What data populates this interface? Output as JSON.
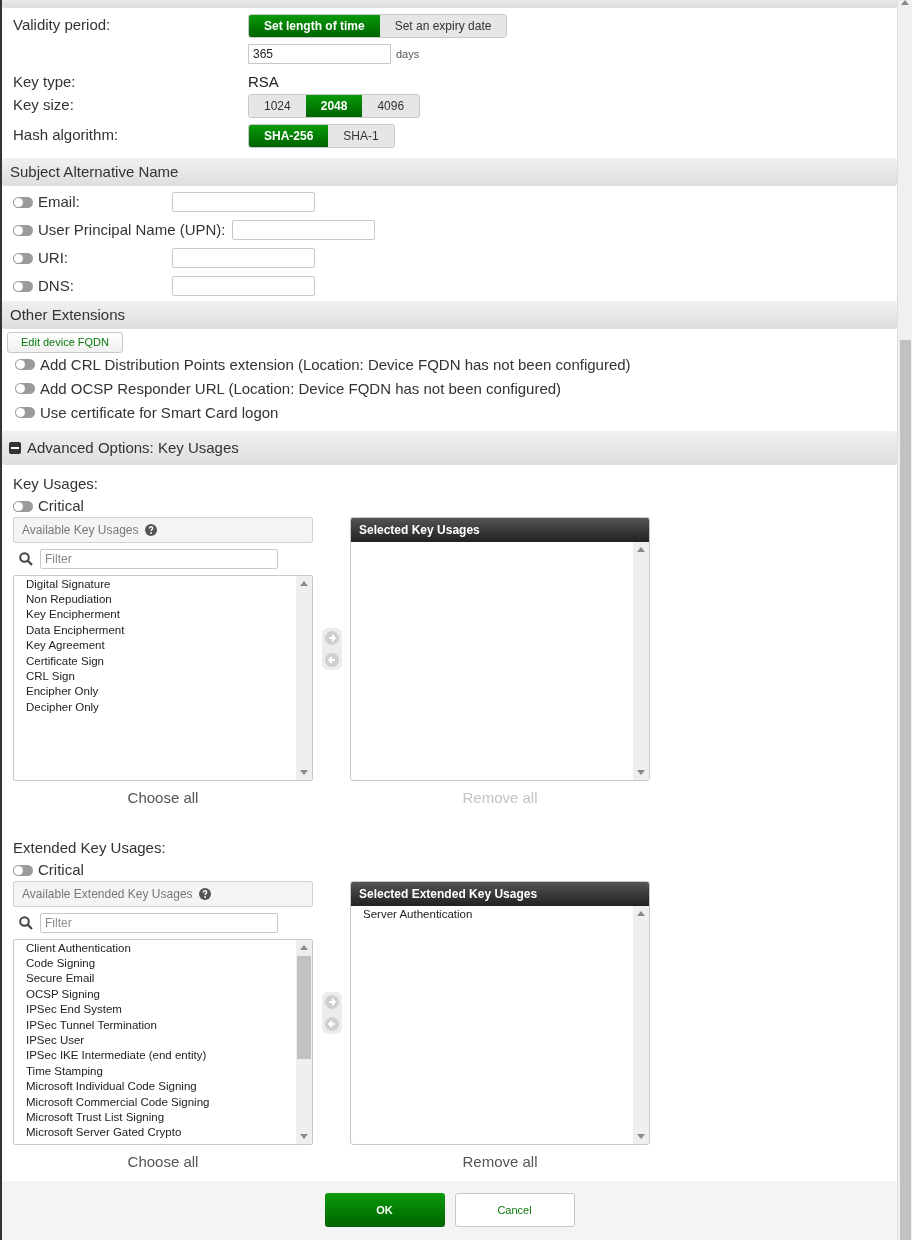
{
  "validity": {
    "label": "Validity period:",
    "options": [
      {
        "label": "Set length of time",
        "selected": true
      },
      {
        "label": "Set an expiry date",
        "selected": false
      }
    ],
    "value": "365",
    "unit": "days"
  },
  "key_type": {
    "label": "Key type:",
    "value": "RSA"
  },
  "key_size": {
    "label": "Key size:",
    "options": [
      {
        "label": "1024",
        "selected": false
      },
      {
        "label": "2048",
        "selected": true
      },
      {
        "label": "4096",
        "selected": false
      }
    ]
  },
  "hash": {
    "label": "Hash algorithm:",
    "options": [
      {
        "label": "SHA-256",
        "selected": true
      },
      {
        "label": "SHA-1",
        "selected": false
      }
    ]
  },
  "san": {
    "title": "Subject Alternative Name",
    "fields": [
      {
        "label": "Email:",
        "on": false
      },
      {
        "label": "User Principal Name (UPN):",
        "on": false
      },
      {
        "label": "URI:",
        "on": false
      },
      {
        "label": "DNS:",
        "on": false
      }
    ]
  },
  "other": {
    "title": "Other Extensions",
    "edit_button": "Edit device FQDN",
    "toggles": [
      {
        "label": "Add CRL Distribution Points extension (Location: Device FQDN has not been configured)",
        "on": false
      },
      {
        "label": "Add OCSP Responder URL (Location: Device FQDN has not been configured)",
        "on": false
      },
      {
        "label": "Use certificate for Smart Card logon",
        "on": false
      }
    ]
  },
  "advanced": {
    "title": "Advanced Options: Key Usages",
    "expanded": true
  },
  "usage_groups": [
    {
      "label": "Key Usages:",
      "critical": {
        "label": "Critical",
        "on": false
      },
      "available_title": "Available Key Usages",
      "filter_placeholder": "Filter",
      "available": [
        "Digital Signature",
        "Non Repudiation",
        "Key Encipherment",
        "Data Encipherment",
        "Key Agreement",
        "Certificate Sign",
        "CRL Sign",
        "Encipher Only",
        "Decipher Only"
      ],
      "available_scrollable": false,
      "selected_title": "Selected Key Usages",
      "choose_all": {
        "label": "Choose all",
        "disabled": false
      },
      "remove_all": {
        "label": "Remove all",
        "disabled": true
      }
    },
    {
      "label": "Extended Key Usages:",
      "critical": {
        "label": "Critical",
        "on": false
      },
      "available_title": "Available Extended Key Usages",
      "filter_placeholder": "Filter",
      "available": [
        "Client Authentication",
        "Code Signing",
        "Secure Email",
        "OCSP Signing",
        "IPSec End System",
        "IPSec Tunnel Termination",
        "IPSec User",
        "IPSec IKE Intermediate (end entity)",
        "Time Stamping",
        "Microsoft Individual Code Signing",
        "Microsoft Commercial Code Signing",
        "Microsoft Trust List Signing",
        "Microsoft Server Gated Crypto"
      ],
      "available_scrollable": true,
      "selected_title": "Selected Extended Key Usages",
      "selected": [
        "Server Authentication"
      ],
      "choose_all": {
        "label": "Choose all",
        "disabled": false
      },
      "remove_all": {
        "label": "Remove all",
        "disabled": false
      }
    }
  ],
  "footer": {
    "ok": "OK",
    "cancel": "Cancel"
  }
}
